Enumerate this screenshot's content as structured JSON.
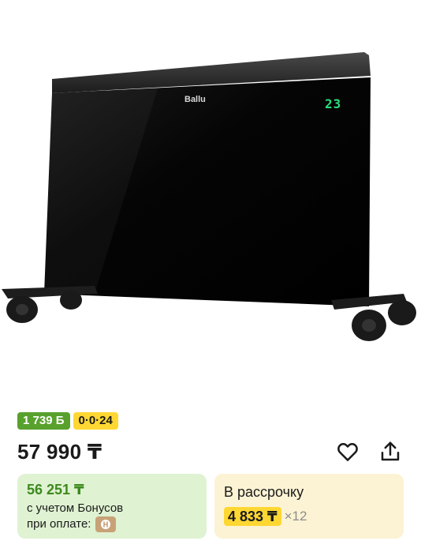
{
  "product": {
    "brand_logo": "Ballu",
    "display_temp": "23"
  },
  "badges": {
    "bonus": "1 739 Б",
    "installment": "0·0·24"
  },
  "price": "57 990 ₸",
  "icons": {
    "favorite": "heart-icon",
    "share": "share-icon"
  },
  "bonus_card": {
    "price": "56 251 ₸",
    "line1": "с учетом Бонусов",
    "line2": "при оплате:"
  },
  "installment_card": {
    "title": "В рассрочку",
    "amount": "4 833 ₸",
    "multiplier": "×12"
  },
  "colors": {
    "bonus_green": "#58a12d",
    "installment_yellow": "#ffd733",
    "bonus_card_bg": "#dff2d2",
    "installment_card_bg": "#fcf3d4"
  }
}
